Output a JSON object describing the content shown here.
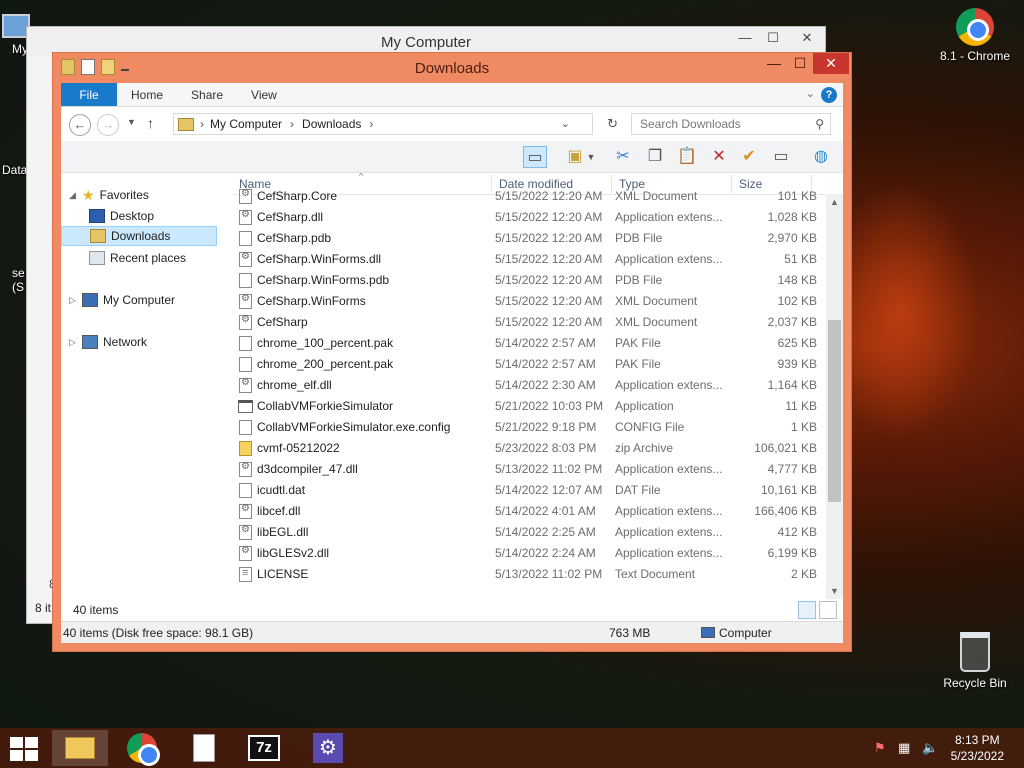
{
  "desktop": {
    "left_icons": [
      "My C",
      "Data",
      "se",
      "(S"
    ],
    "chrome_label": "8.1 - Chrome",
    "recycle_label": "Recycle Bin"
  },
  "back_window": {
    "title": "My Computer",
    "status": "8 it",
    "side_digit": "8",
    "controls": [
      "—",
      "☐",
      "✕"
    ]
  },
  "window": {
    "title": "Downloads",
    "controls": [
      "—",
      "☐",
      "✕"
    ],
    "tabs": [
      "File",
      "Home",
      "Share",
      "View"
    ],
    "help": "?",
    "address": [
      "My Computer",
      "Downloads"
    ],
    "search_placeholder": "Search Downloads",
    "nav": {
      "favorites": "Favorites",
      "desktop": "Desktop",
      "downloads": "Downloads",
      "recent": "Recent places",
      "computer": "My Computer",
      "network": "Network"
    },
    "columns": [
      "Name",
      "Date modified",
      "Type",
      "Size"
    ],
    "files": [
      {
        "name": "CefSharp.Core",
        "date": "5/15/2022 12:20 AM",
        "type": "XML Document",
        "size": "101 KB",
        "icon": "gear"
      },
      {
        "name": "CefSharp.dll",
        "date": "5/15/2022 12:20 AM",
        "type": "Application extens...",
        "size": "1,028 KB",
        "icon": "gear"
      },
      {
        "name": "CefSharp.pdb",
        "date": "5/15/2022 12:20 AM",
        "type": "PDB File",
        "size": "2,970 KB",
        "icon": "blank"
      },
      {
        "name": "CefSharp.WinForms.dll",
        "date": "5/15/2022 12:20 AM",
        "type": "Application extens...",
        "size": "51 KB",
        "icon": "gear"
      },
      {
        "name": "CefSharp.WinForms.pdb",
        "date": "5/15/2022 12:20 AM",
        "type": "PDB File",
        "size": "148 KB",
        "icon": "blank"
      },
      {
        "name": "CefSharp.WinForms",
        "date": "5/15/2022 12:20 AM",
        "type": "XML Document",
        "size": "102 KB",
        "icon": "gear"
      },
      {
        "name": "CefSharp",
        "date": "5/15/2022 12:20 AM",
        "type": "XML Document",
        "size": "2,037 KB",
        "icon": "gear"
      },
      {
        "name": "chrome_100_percent.pak",
        "date": "5/14/2022 2:57 AM",
        "type": "PAK File",
        "size": "625 KB",
        "icon": "blank"
      },
      {
        "name": "chrome_200_percent.pak",
        "date": "5/14/2022 2:57 AM",
        "type": "PAK File",
        "size": "939 KB",
        "icon": "blank"
      },
      {
        "name": "chrome_elf.dll",
        "date": "5/14/2022 2:30 AM",
        "type": "Application extens...",
        "size": "1,164 KB",
        "icon": "gear"
      },
      {
        "name": "CollabVMForkieSimulator",
        "date": "5/21/2022 10:03 PM",
        "type": "Application",
        "size": "11 KB",
        "icon": "app"
      },
      {
        "name": "CollabVMForkieSimulator.exe.config",
        "date": "5/21/2022 9:18 PM",
        "type": "CONFIG File",
        "size": "1 KB",
        "icon": "blank"
      },
      {
        "name": "cvmf-05212022",
        "date": "5/23/2022 8:03 PM",
        "type": "zip Archive",
        "size": "106,021 KB",
        "icon": "zip"
      },
      {
        "name": "d3dcompiler_47.dll",
        "date": "5/13/2022 11:02 PM",
        "type": "Application extens...",
        "size": "4,777 KB",
        "icon": "gear"
      },
      {
        "name": "icudtl.dat",
        "date": "5/14/2022 12:07 AM",
        "type": "DAT File",
        "size": "10,161 KB",
        "icon": "blank"
      },
      {
        "name": "libcef.dll",
        "date": "5/14/2022 4:01 AM",
        "type": "Application extens...",
        "size": "166,406 KB",
        "icon": "gear"
      },
      {
        "name": "libEGL.dll",
        "date": "5/14/2022 2:25 AM",
        "type": "Application extens...",
        "size": "412 KB",
        "icon": "gear"
      },
      {
        "name": "libGLESv2.dll",
        "date": "5/14/2022 2:24 AM",
        "type": "Application extens...",
        "size": "6,199 KB",
        "icon": "gear"
      },
      {
        "name": "LICENSE",
        "date": "5/13/2022 11:02 PM",
        "type": "Text Document",
        "size": "2 KB",
        "icon": "text"
      }
    ],
    "items_count": "40 items",
    "status_left": "40 items (Disk free space: 98.1 GB)",
    "status_size": "763 MB",
    "status_location": "Computer"
  },
  "taskbar": {
    "time": "8:13 PM",
    "date": "5/23/2022",
    "sevenzip": "7z"
  }
}
